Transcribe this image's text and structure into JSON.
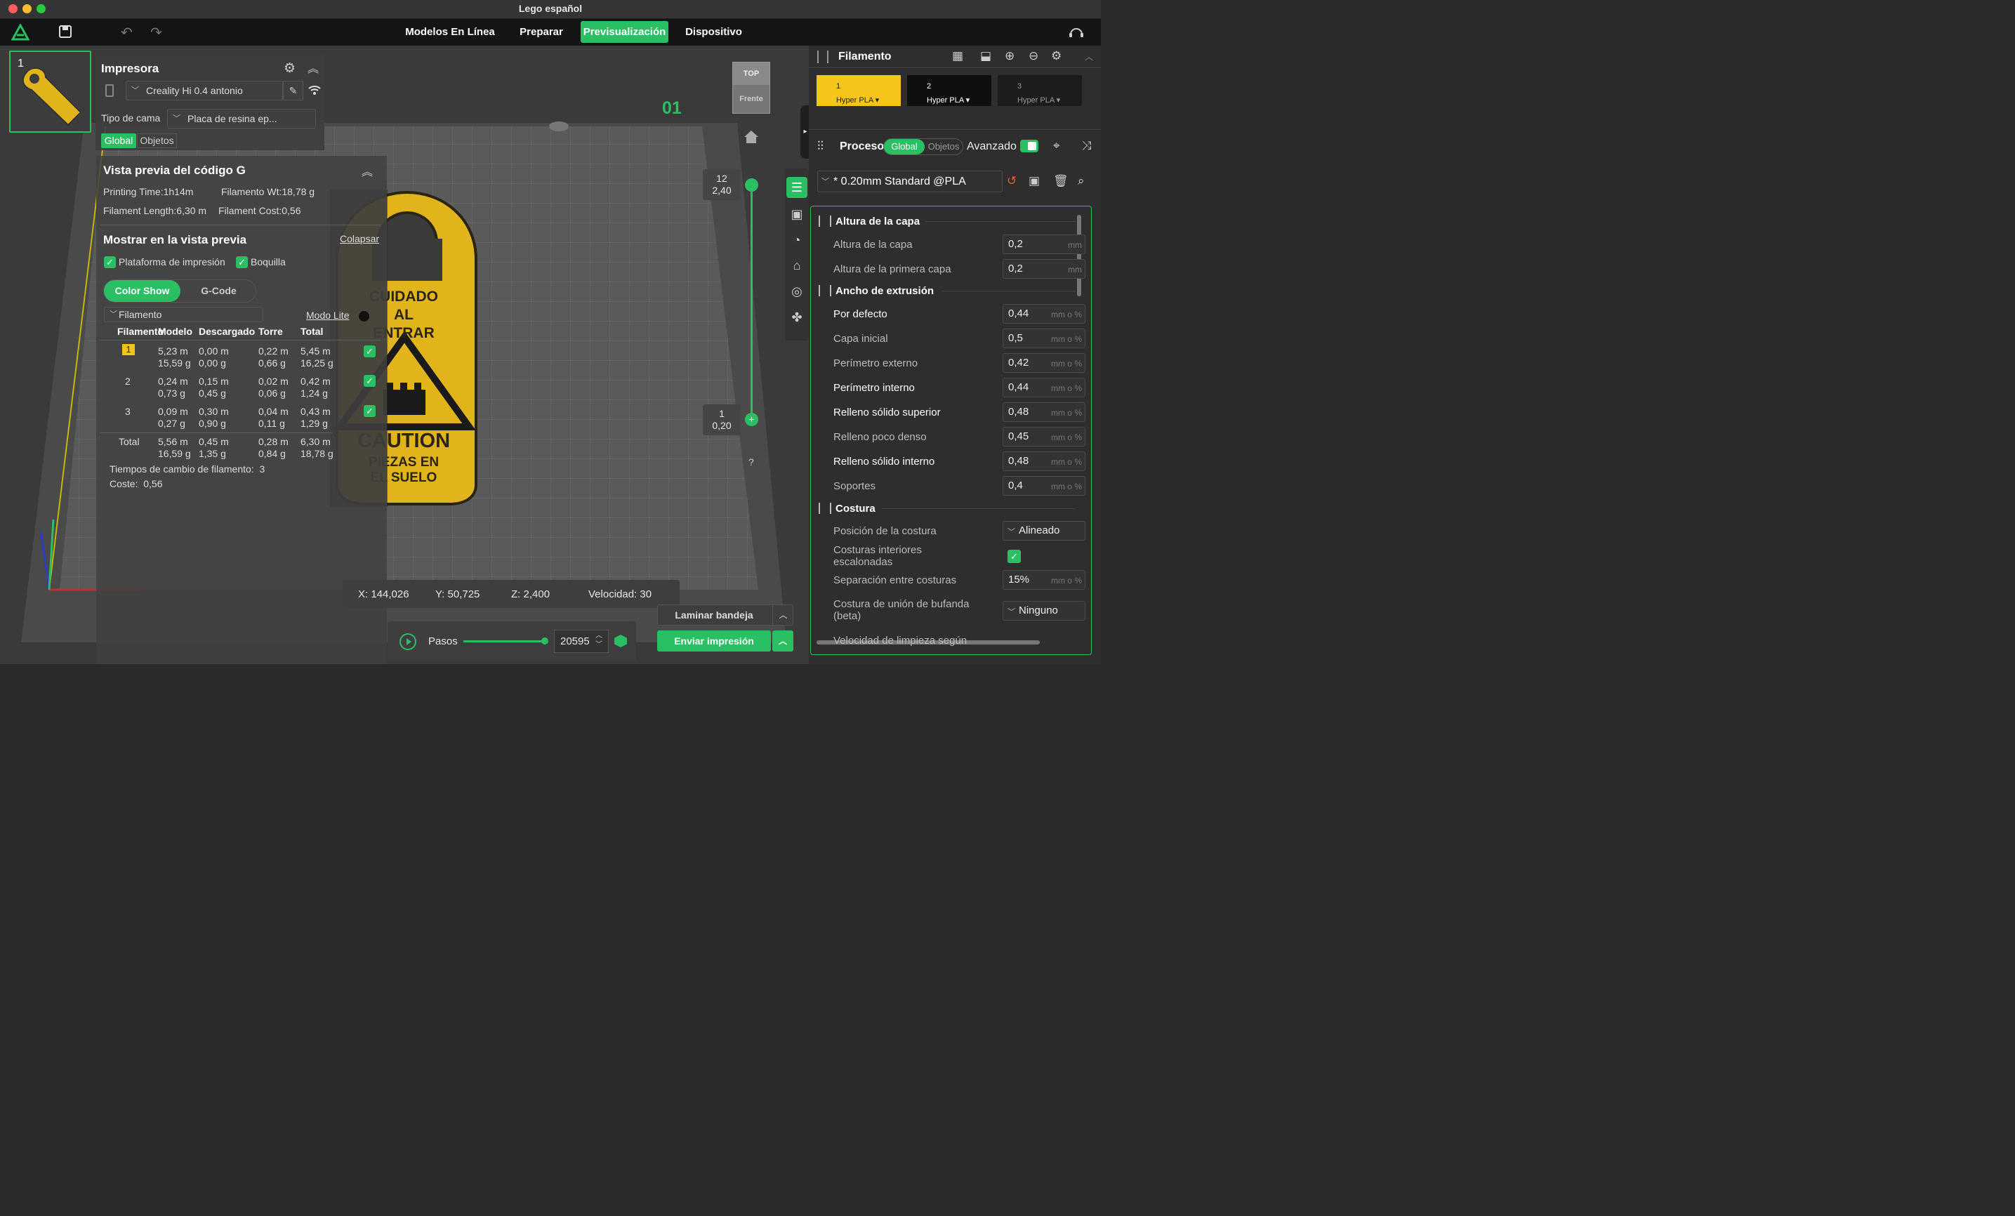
{
  "window": {
    "title": "Lego español"
  },
  "nav": {
    "tabs": [
      "Modelos En Línea",
      "Preparar",
      "Previsualización",
      "Dispositivo"
    ],
    "active": "Previsualización"
  },
  "plate": {
    "number": "1",
    "plate_label": "01"
  },
  "cube": {
    "top": "TOP",
    "front": "Frente"
  },
  "printer": {
    "title": "Impresora",
    "printer_name": "Creality Hi 0.4 antonio",
    "bed_label": "Tipo de cama",
    "bed_value": "Placa de resina ep...",
    "tab_global": "Global",
    "tab_objects": "Objetos"
  },
  "gcode": {
    "title": "Vista previa del código G",
    "printing_time": "Printing Time:1h14m",
    "filament_wt": "Filamento Wt:18,78 g",
    "filament_length": "Filament Length:6,30 m",
    "filament_cost": "Filament Cost:0,56",
    "show_title": "Mostrar en la vista previa",
    "collapse": "Colapsar",
    "opt_platform": "Plataforma de impresión",
    "opt_nozzle": "Boquilla",
    "mode_color": "Color Show",
    "mode_gcode": "G-Code",
    "filament_dd": "Filamento",
    "lite_mode": "Modo Lite",
    "headers": [
      "Filamento",
      "Modelo",
      "Descargado",
      "Torre",
      "Total"
    ],
    "rows": [
      {
        "id": "1",
        "model": [
          "5,23 m",
          "15,59 g"
        ],
        "discard": [
          "0,00 m",
          "0,00 g"
        ],
        "tower": [
          "0,22 m",
          "0,66 g"
        ],
        "total": [
          "5,45 m",
          "16,25 g"
        ],
        "color": "#f2c31a"
      },
      {
        "id": "2",
        "model": [
          "0,24 m",
          "0,73 g"
        ],
        "discard": [
          "0,15 m",
          "0,45 g"
        ],
        "tower": [
          "0,02 m",
          "0,06 g"
        ],
        "total": [
          "0,42 m",
          "1,24 g"
        ],
        "color": "#111111"
      },
      {
        "id": "3",
        "model": [
          "0,09 m",
          "0,27 g"
        ],
        "discard": [
          "0,30 m",
          "0,90 g"
        ],
        "tower": [
          "0,04 m",
          "0,11 g"
        ],
        "total": [
          "0,43 m",
          "1,29 g"
        ],
        "color": "#222222"
      }
    ],
    "total_row": {
      "label": "Total",
      "model": [
        "5,56 m",
        "16,59 g"
      ],
      "discard": [
        "0,45 m",
        "1,35 g"
      ],
      "tower": [
        "0,28 m",
        "0,84 g"
      ],
      "total": [
        "6,30 m",
        "18,78 g"
      ]
    },
    "changes": "Tiempos de cambio de filamento:  3",
    "cost": "Coste:  0,56"
  },
  "model_text": {
    "l1": "CUIDADO",
    "l2": "AL",
    "l3": "ENTRAR",
    "l4": "CAUTION",
    "l5": "PIEZAS EN",
    "l6": "EL SUELO"
  },
  "layers": {
    "top_layer": "12",
    "top_height": "2,40",
    "bottom_layer": "1",
    "bottom_height": "0,20",
    "help": "?"
  },
  "coords": {
    "x": "X: 144,026",
    "y": "Y: 50,725",
    "z": "Z: 2,400",
    "speed": "Velocidad: 30"
  },
  "steps": {
    "label": "Pasos",
    "value": "20595"
  },
  "actions": {
    "slice": "Laminar bandeja",
    "send": "Enviar impresión"
  },
  "filament": {
    "title": "Filamento",
    "slots": [
      {
        "num": "1",
        "name": "Hyper PLA",
        "bg": "#f5c518",
        "fg": "#222"
      },
      {
        "num": "2",
        "name": "Hyper PLA",
        "bg": "#0f0f0f",
        "fg": "#fff"
      },
      {
        "num": "3",
        "name": "Hyper PLA",
        "bg": "#1c1c1c",
        "fg": "#aaa"
      }
    ]
  },
  "process": {
    "title": "Proceso",
    "tab_global": "Global",
    "tab_objects": "Objetos",
    "advanced": "Avanzado",
    "preset": "* 0.20mm Standard @PLA"
  },
  "params": {
    "layer_height_h": "Altura de la capa",
    "layer_height": {
      "label": "Altura de la capa",
      "value": "0,2",
      "unit": "mm"
    },
    "first_layer": {
      "label": "Altura de la primera capa",
      "value": "0,2",
      "unit": "mm"
    },
    "extrusion_h": "Ancho de extrusión",
    "default": {
      "label": "Por defecto",
      "value": "0,44",
      "unit": "mm o %"
    },
    "initial": {
      "label": "Capa inicial",
      "value": "0,5",
      "unit": "mm o %"
    },
    "outer": {
      "label": "Perímetro externo",
      "value": "0,42",
      "unit": "mm o %"
    },
    "inner": {
      "label": "Perímetro interno",
      "value": "0,44",
      "unit": "mm o %"
    },
    "top_solid": {
      "label": "Relleno sólido superior",
      "value": "0,48",
      "unit": "mm o %"
    },
    "sparse": {
      "label": "Relleno poco denso",
      "value": "0,45",
      "unit": "mm o %"
    },
    "internal_solid": {
      "label": "Relleno sólido interno",
      "value": "0,48",
      "unit": "mm o %"
    },
    "supports": {
      "label": "Soportes",
      "value": "0,4",
      "unit": "mm o %"
    },
    "seam_h": "Costura",
    "seam_pos": {
      "label": "Posición de la costura",
      "value": "Alineado"
    },
    "staggered": {
      "label1": "Costuras interiores",
      "label2": "escalonadas"
    },
    "seam_gap": {
      "label": "Separación entre costuras",
      "value": "15%",
      "unit": "mm o %"
    },
    "scarf": {
      "label1": "Costura de unión de bufanda",
      "label2": "(beta)",
      "value": "Ninguno"
    },
    "wipe": {
      "label": "Velocidad de limpieza según"
    }
  }
}
